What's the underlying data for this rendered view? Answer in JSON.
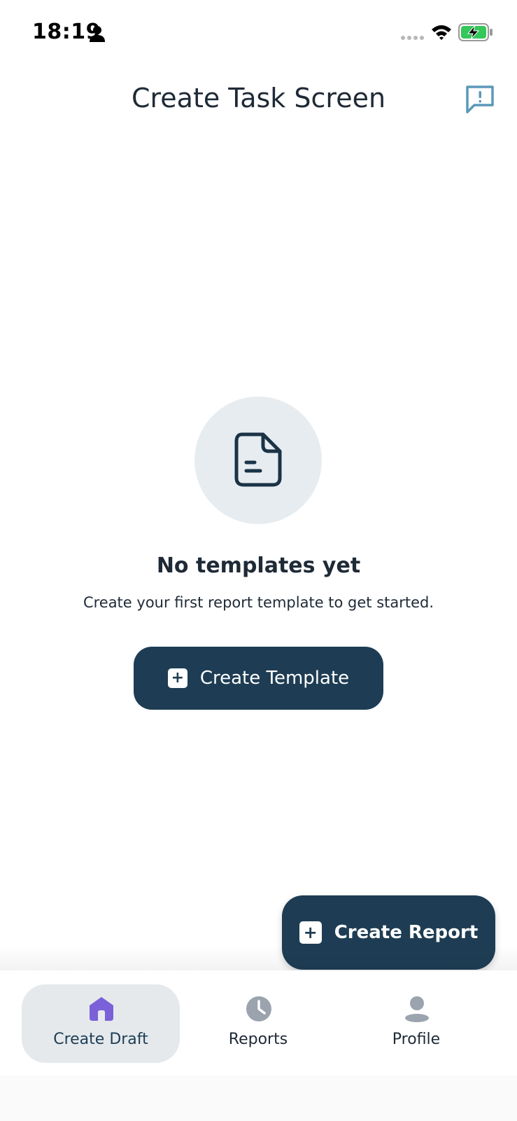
{
  "status_bar": {
    "time": "18:19",
    "icons": [
      "person-icon",
      "signal-icon",
      "wifi-icon",
      "battery-charging-icon"
    ],
    "battery_color": "#34c759"
  },
  "header": {
    "title": "Create Task Screen",
    "feedback_icon": "feedback-icon"
  },
  "empty_state": {
    "icon": "document-icon",
    "title": "No templates yet",
    "subtitle": "Create your first report template to get started.",
    "button_label": "Create Template",
    "button_icon": "plus-square-icon"
  },
  "fab": {
    "label": "Create Report",
    "icon": "plus-square-icon"
  },
  "bottom_nav": {
    "items": [
      {
        "label": "Create Draft",
        "icon": "home-icon",
        "active": true
      },
      {
        "label": "Reports",
        "icon": "clock-icon",
        "active": false
      },
      {
        "label": "Profile",
        "icon": "profile-icon",
        "active": false
      }
    ]
  },
  "colors": {
    "primary": "#1e3d54",
    "active_icon": "#7b61d9",
    "inactive_icon": "#9ba4ae",
    "feedback_icon": "#5b98b8"
  }
}
